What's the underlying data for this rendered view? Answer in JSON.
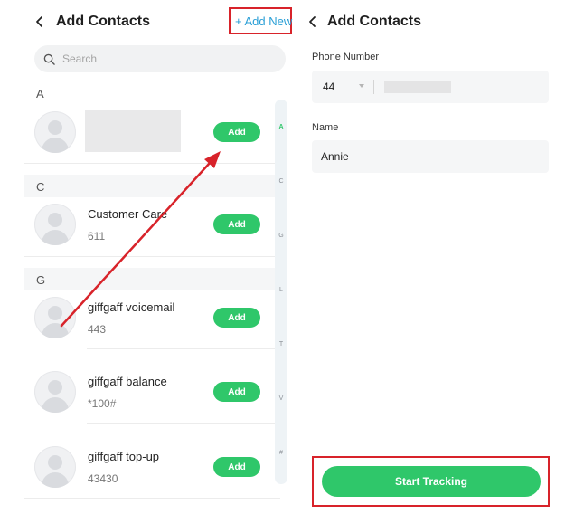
{
  "left": {
    "title": "Add Contacts",
    "add_new": "+ Add New",
    "search": {
      "placeholder": "Search"
    },
    "groups": [
      {
        "letter": "A"
      },
      {
        "letter": "C"
      },
      {
        "letter": "G"
      }
    ],
    "contacts": [
      {
        "name": "",
        "number": "",
        "add_label": "Add"
      },
      {
        "name": "Customer Care",
        "number": "611",
        "add_label": "Add"
      },
      {
        "name": "giffgaff voicemail",
        "number": "443",
        "add_label": "Add"
      },
      {
        "name": "giffgaff balance",
        "number": "*100#",
        "add_label": "Add"
      },
      {
        "name": "giffgaff top-up",
        "number": "43430",
        "add_label": "Add"
      }
    ],
    "index_letters": [
      "A",
      "C",
      "G",
      "L",
      "T",
      "V",
      "#"
    ]
  },
  "right": {
    "title": "Add Contacts",
    "phone_label": "Phone Number",
    "country_code": "44",
    "name_label": "Name",
    "name_value": "Annie",
    "start_button": "Start Tracking"
  },
  "colors": {
    "accent_green": "#2fc76a",
    "highlight_red": "#d8232a",
    "link_blue": "#2a9fd6"
  }
}
